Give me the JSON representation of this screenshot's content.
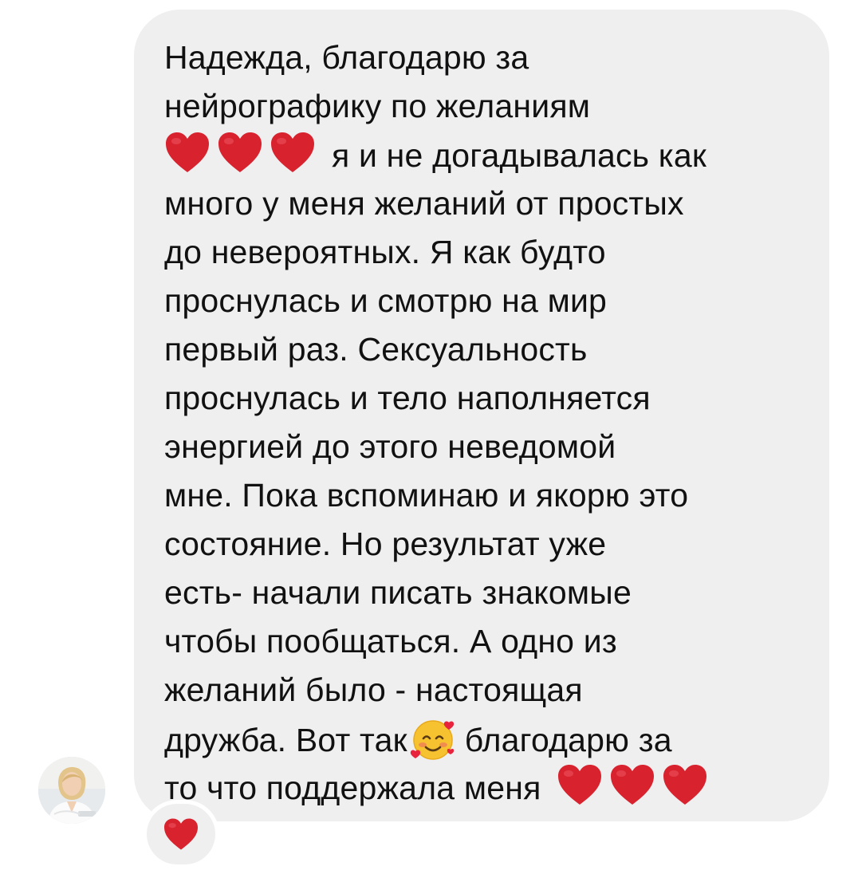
{
  "message": {
    "lines": [
      "Надежда, благодарю за",
      "нейрографику по желаниям",
      "я и не догадывалась как",
      "много у меня желаний от простых",
      "до невероятных. Я как будто",
      "проснулась и смотрю на мир",
      "первый раз. Сексуальность",
      "проснулась и тело наполняется",
      "энергией до этого неведомой",
      "мне. Пока вспоминаю и якорю это",
      "состояние. Но результат уже",
      "есть- начали писать знакомые",
      "чтобы пообщаться. А одно из",
      "желаний было - настоящая",
      "дружба. Вот так",
      "благодарю за",
      "то что поддержала меня"
    ]
  },
  "colors": {
    "bubble": "#efeff0",
    "text": "#111111",
    "heart": "#d8232f"
  },
  "icons": {
    "heart": "red-heart-icon",
    "blush": "smiling-face-with-hearts-icon",
    "reaction": "red-heart-icon",
    "avatar": "profile-photo"
  }
}
